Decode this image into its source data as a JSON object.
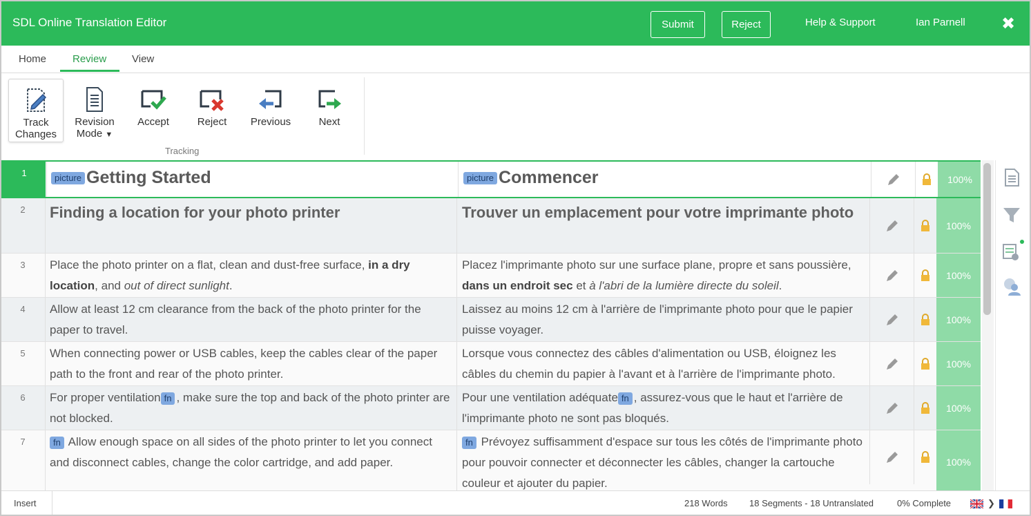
{
  "header": {
    "title": "SDL Online Translation Editor",
    "submit_label": "Submit",
    "reject_label": "Reject",
    "help_label": "Help & Support",
    "user_name": "Ian Parnell",
    "close_symbol": "✖"
  },
  "tabs": [
    {
      "label": "Home"
    },
    {
      "label": "Review",
      "active": true
    },
    {
      "label": "View"
    }
  ],
  "ribbon": {
    "track_changes": [
      "Track",
      "Changes"
    ],
    "revision_mode": [
      "Revision",
      "Mode"
    ],
    "accept": "Accept",
    "reject": "Reject",
    "previous": "Previous",
    "next": "Next",
    "group_label": "Tracking"
  },
  "segments": [
    {
      "num": "1",
      "tag": "picture",
      "source": "Getting Started",
      "target_tag": "picture",
      "target": "Commencer",
      "match": "100%"
    },
    {
      "num": "2",
      "source": "Finding a location for your photo printer",
      "target": "Trouver un emplacement pour votre imprimante photo",
      "match": "100%"
    },
    {
      "num": "3",
      "source_parts": [
        "Place the photo printer on a flat, clean and dust-free surface, ",
        "in a dry location",
        ", and ",
        "out of direct sunlight",
        "."
      ],
      "target_parts": [
        "Placez l'imprimante photo sur une surface plane, propre et sans poussière, ",
        "dans un endroit sec",
        " et ",
        "à l'abri de la lumière directe du soleil",
        "."
      ],
      "match": "100%"
    },
    {
      "num": "4",
      "source": "Allow at least 12 cm clearance from the back of the photo printer for the paper to travel.",
      "target": "Laissez au moins 12 cm à l'arrière de l'imprimante photo pour que le papier puisse voyager.",
      "match": "100%"
    },
    {
      "num": "5",
      "source": "When connecting power or USB cables, keep the cables clear of the paper path to the front and rear of the photo printer.",
      "target": "Lorsque vous connectez des câbles d'alimentation ou USB, éloignez les câbles du chemin du papier à l'avant et à l'arrière de l'imprimante photo.",
      "match": "100%"
    },
    {
      "num": "6",
      "source_a": "For proper ventilation",
      "source_tag": "fn",
      "source_b": ", make sure the top and back of the photo printer are not blocked.",
      "target_a": "Pour une ventilation adéquate",
      "target_tag": "fn",
      "target_b": ", assurez-vous que le haut et l'arrière de l'imprimante photo ne sont pas bloqués.",
      "match": "100%"
    },
    {
      "num": "7",
      "source_tag": "fn",
      "source": " Allow enough space on all sides of the photo printer to let you connect and disconnect cables, change the color cartridge, and add paper.",
      "target_tag": "fn",
      "target": " Prévoyez suffisamment d'espace sur tous les côtés de l'imprimante photo pour pouvoir connecter et déconnecter les câbles, changer la cartouche couleur et ajouter du papier.",
      "match": "100%"
    }
  ],
  "status": {
    "mode": "Insert",
    "words": "218 Words",
    "segments": "18 Segments - 18 Untranslated",
    "complete": "0% Complete",
    "arrow": "❯"
  },
  "colors": {
    "brand_green": "#2cba5a",
    "match_green": "#8fdba7",
    "tag_blue": "#7fa8e0"
  },
  "icons": [
    "track-changes-icon",
    "revision-mode-icon",
    "accept-icon",
    "reject-icon",
    "previous-icon",
    "next-icon",
    "pencil-icon",
    "lock-icon",
    "document-icon",
    "filter-icon",
    "qa-checker-icon",
    "comments-icon",
    "uk-flag-icon",
    "fr-flag-icon"
  ]
}
